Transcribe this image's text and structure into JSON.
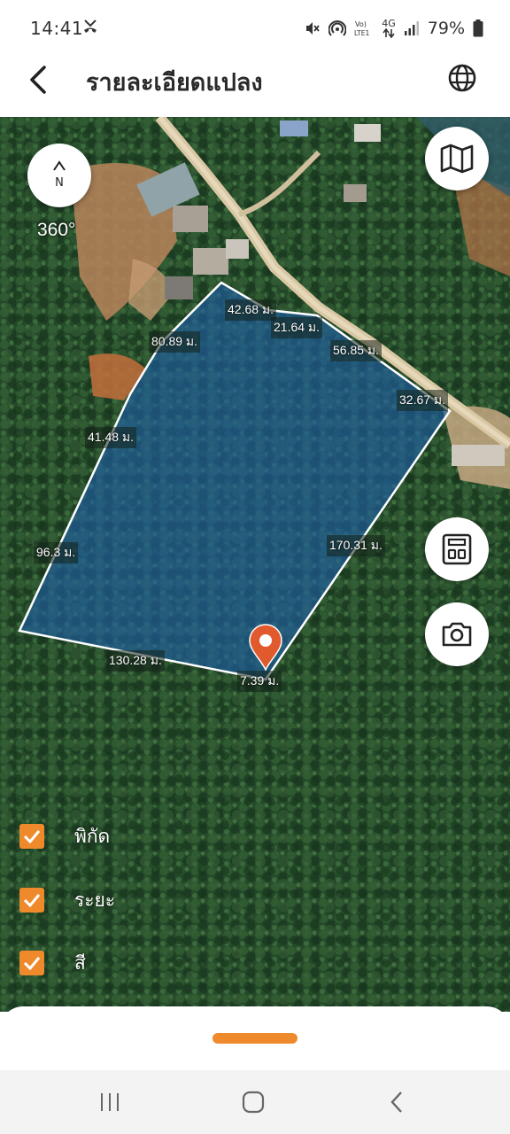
{
  "status_bar": {
    "time": "14:41",
    "network": "4G",
    "battery": "79%",
    "icons": [
      "missed-call-icon",
      "mute-icon",
      "hotspot-icon",
      "volte-icon",
      "data-arrows-icon",
      "signal-icon",
      "battery-icon"
    ]
  },
  "app_bar": {
    "title": "รายละเอียดแปลง",
    "back_icon": "chevron-left-icon",
    "globe_icon": "globe-icon"
  },
  "map": {
    "compass_heading": "360°",
    "compass_north": "N",
    "measurements": [
      "42.68 ม.",
      "21.64 ม.",
      "80.89 ม.",
      "56.85 ม.",
      "32.67 ม.",
      "41.48 ม.",
      "96.3 ม.",
      "170.31 ม.",
      "130.28 ม.",
      "7.39 ม."
    ],
    "buttons": {
      "map_layers_icon": "map-icon",
      "calculator_icon": "calculator-icon",
      "camera_icon": "camera-icon"
    },
    "parcel_color": "#1f5fa8",
    "accent_color": "#ef8a2c"
  },
  "toggles": [
    {
      "label": "พิกัด",
      "checked": true
    },
    {
      "label": "ระยะ",
      "checked": true
    },
    {
      "label": "สี",
      "checked": true
    }
  ],
  "nav_bar": {
    "recents_icon": "recents-icon",
    "home_icon": "home-icon",
    "back_icon": "back-icon"
  }
}
